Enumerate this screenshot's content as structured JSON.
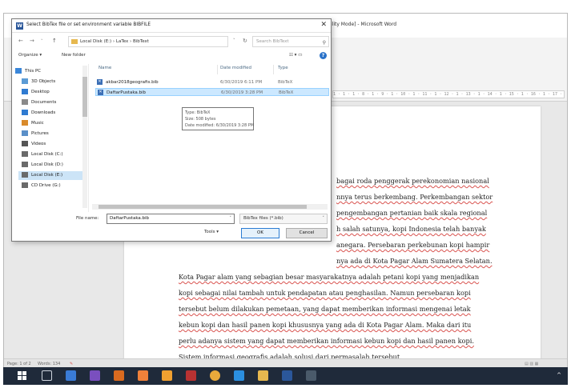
{
  "word": {
    "title": "ility Mode] - Microsoft Word",
    "ruler": "1 · 1 · 1 · 8 · 1 · 9 · 1 · 10 · 1 · 11 · 1 · 12 · 1 · 13 · 1 · 14 · 1 · 15 · 1 · 16 · 1 · 17 · 1 · 18 · 1",
    "doc_lines": [
      "bagai roda penggerak perekonomian nasional",
      "nnya terus berkembang. Perkembangan sektor",
      "pengembangan pertanian baik skala regional",
      "h salah satunya, kopi Indonesia telah banyak",
      "anegara. Persebaran perkebunan kopi hampir",
      "nya ada di Kota Pagar Alam Sumatera Selatan.",
      "Kota Pagar alam yang sebagian besar masyarakatnya adalah petani kopi yang menjadikan",
      "kopi sebagai nilai tambah untuk pendapatan atau penghasilan. Namun persebaran kopi",
      "tersebut belum dilakukan pemetaan, yang dapat memberikan informasi mengenai letak",
      "kebun kopi dan hasil panen kopi khususnya yang ada di Kota Pagar Alam. Maka dari itu",
      "perlu adanya sistem yang dapat memberikan informasi kebun kopi dan hasil panen kopi.",
      "Sistem informasi geografis adalah solusi dari permasalah tersebut."
    ],
    "status": {
      "page": "Page: 1 of 2",
      "words": "Words: 134"
    }
  },
  "dialog": {
    "title": "Select BibTex file or set environment variable BIBFILE",
    "address_path": "Local Disk (E:)  ›  LaTex  ›  BibText",
    "search_placeholder": "Search BibText",
    "organize": "Organize ▾",
    "new_folder": "New folder",
    "nav_items": [
      {
        "label": "This PC",
        "color": "#3a86d9"
      },
      {
        "label": "3D Objects",
        "color": "#5b9bd5"
      },
      {
        "label": "Desktop",
        "color": "#2f7bd1"
      },
      {
        "label": "Documents",
        "color": "#8a8a8a"
      },
      {
        "label": "Downloads",
        "color": "#2f7bd1"
      },
      {
        "label": "Music",
        "color": "#d98a2b"
      },
      {
        "label": "Pictures",
        "color": "#5a8fc8"
      },
      {
        "label": "Videos",
        "color": "#555555"
      },
      {
        "label": "Local Disk (C:)",
        "color": "#6a6a6a"
      },
      {
        "label": "Local Disk (D:)",
        "color": "#6a6a6a"
      },
      {
        "label": "Local Disk (E:)",
        "color": "#6a6a6a"
      },
      {
        "label": "CD Drive (G:)",
        "color": "#6a6a6a"
      }
    ],
    "columns": {
      "name": "Name",
      "date": "Date modified",
      "type": "Type"
    },
    "files": [
      {
        "name": "akbar2018geografis.bib",
        "date": "6/30/2019 6:11 PM",
        "type": "BibTeX"
      },
      {
        "name": "DaftarPustaka.bib",
        "date": "6/30/2019 3:28 PM",
        "type": "BibTeX"
      }
    ],
    "tooltip": {
      "type": "Type: BibTeX",
      "size": "Size: 508 bytes",
      "date": "Date modified: 6/30/2019 3:28 PM"
    },
    "file_name_label": "File name:",
    "file_name_value": "DaftarPustaka.bib",
    "file_type": "BibTex files (*.bib)",
    "tools": "Tools ▾",
    "ok": "OK",
    "cancel": "Cancel"
  },
  "taskbar": {
    "items": [
      {
        "name": "task-view-icon",
        "color": "#1f2a3a"
      },
      {
        "name": "publisher-icon",
        "color": "#3a7bd5"
      },
      {
        "name": "publisher-2-icon",
        "color": "#7a4fbf"
      },
      {
        "name": "illustrator-icon",
        "color": "#d96a1f"
      },
      {
        "name": "xampp-icon",
        "color": "#f0813a"
      },
      {
        "name": "sublime-icon",
        "color": "#f0a030"
      },
      {
        "name": "access-icon",
        "color": "#b83232"
      },
      {
        "name": "chrome-icon",
        "color": "#e8a93b"
      },
      {
        "name": "vscode-icon",
        "color": "#2b8fe0"
      },
      {
        "name": "file-explorer-icon",
        "color": "#e6b84f"
      },
      {
        "name": "word-icon",
        "color": "#2b579a"
      },
      {
        "name": "app-icon",
        "color": "#4a5a6a"
      }
    ]
  }
}
